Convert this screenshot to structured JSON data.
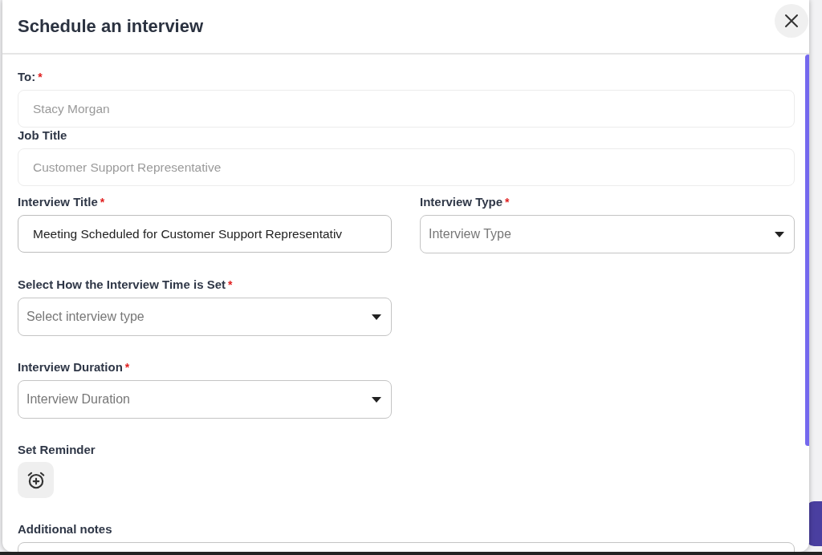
{
  "dialog": {
    "title": "Schedule an interview"
  },
  "required_marker": "*",
  "rows": [
    [
      {
        "kind": "text",
        "label": "To:",
        "required": true,
        "value": "Stacy Morgan",
        "disabled": true
      }
    ],
    [
      {
        "kind": "text",
        "label": "Job Title",
        "required": false,
        "value": "Customer Support Representative",
        "disabled": true
      }
    ],
    [
      {
        "kind": "text",
        "label": "Interview Title",
        "required": true,
        "value": "Meeting Scheduled for Customer Support Representativ",
        "disabled": false
      },
      {
        "kind": "select",
        "label": "Interview Type",
        "required": true,
        "placeholder": "Interview Type",
        "disabled": false
      }
    ],
    [
      {
        "kind": "select",
        "label": "Select How the Interview Time is Set",
        "required": true,
        "placeholder": "Select interview type",
        "disabled": false
      }
    ],
    [
      {
        "kind": "select",
        "label": "Interview Duration",
        "required": true,
        "placeholder": "Interview Duration",
        "disabled": false
      }
    ],
    [
      {
        "kind": "reminder",
        "label": "Set Reminder",
        "required": false
      }
    ],
    [
      {
        "kind": "textarea",
        "label": "Additional notes",
        "required": false,
        "disabled": false
      }
    ]
  ]
}
